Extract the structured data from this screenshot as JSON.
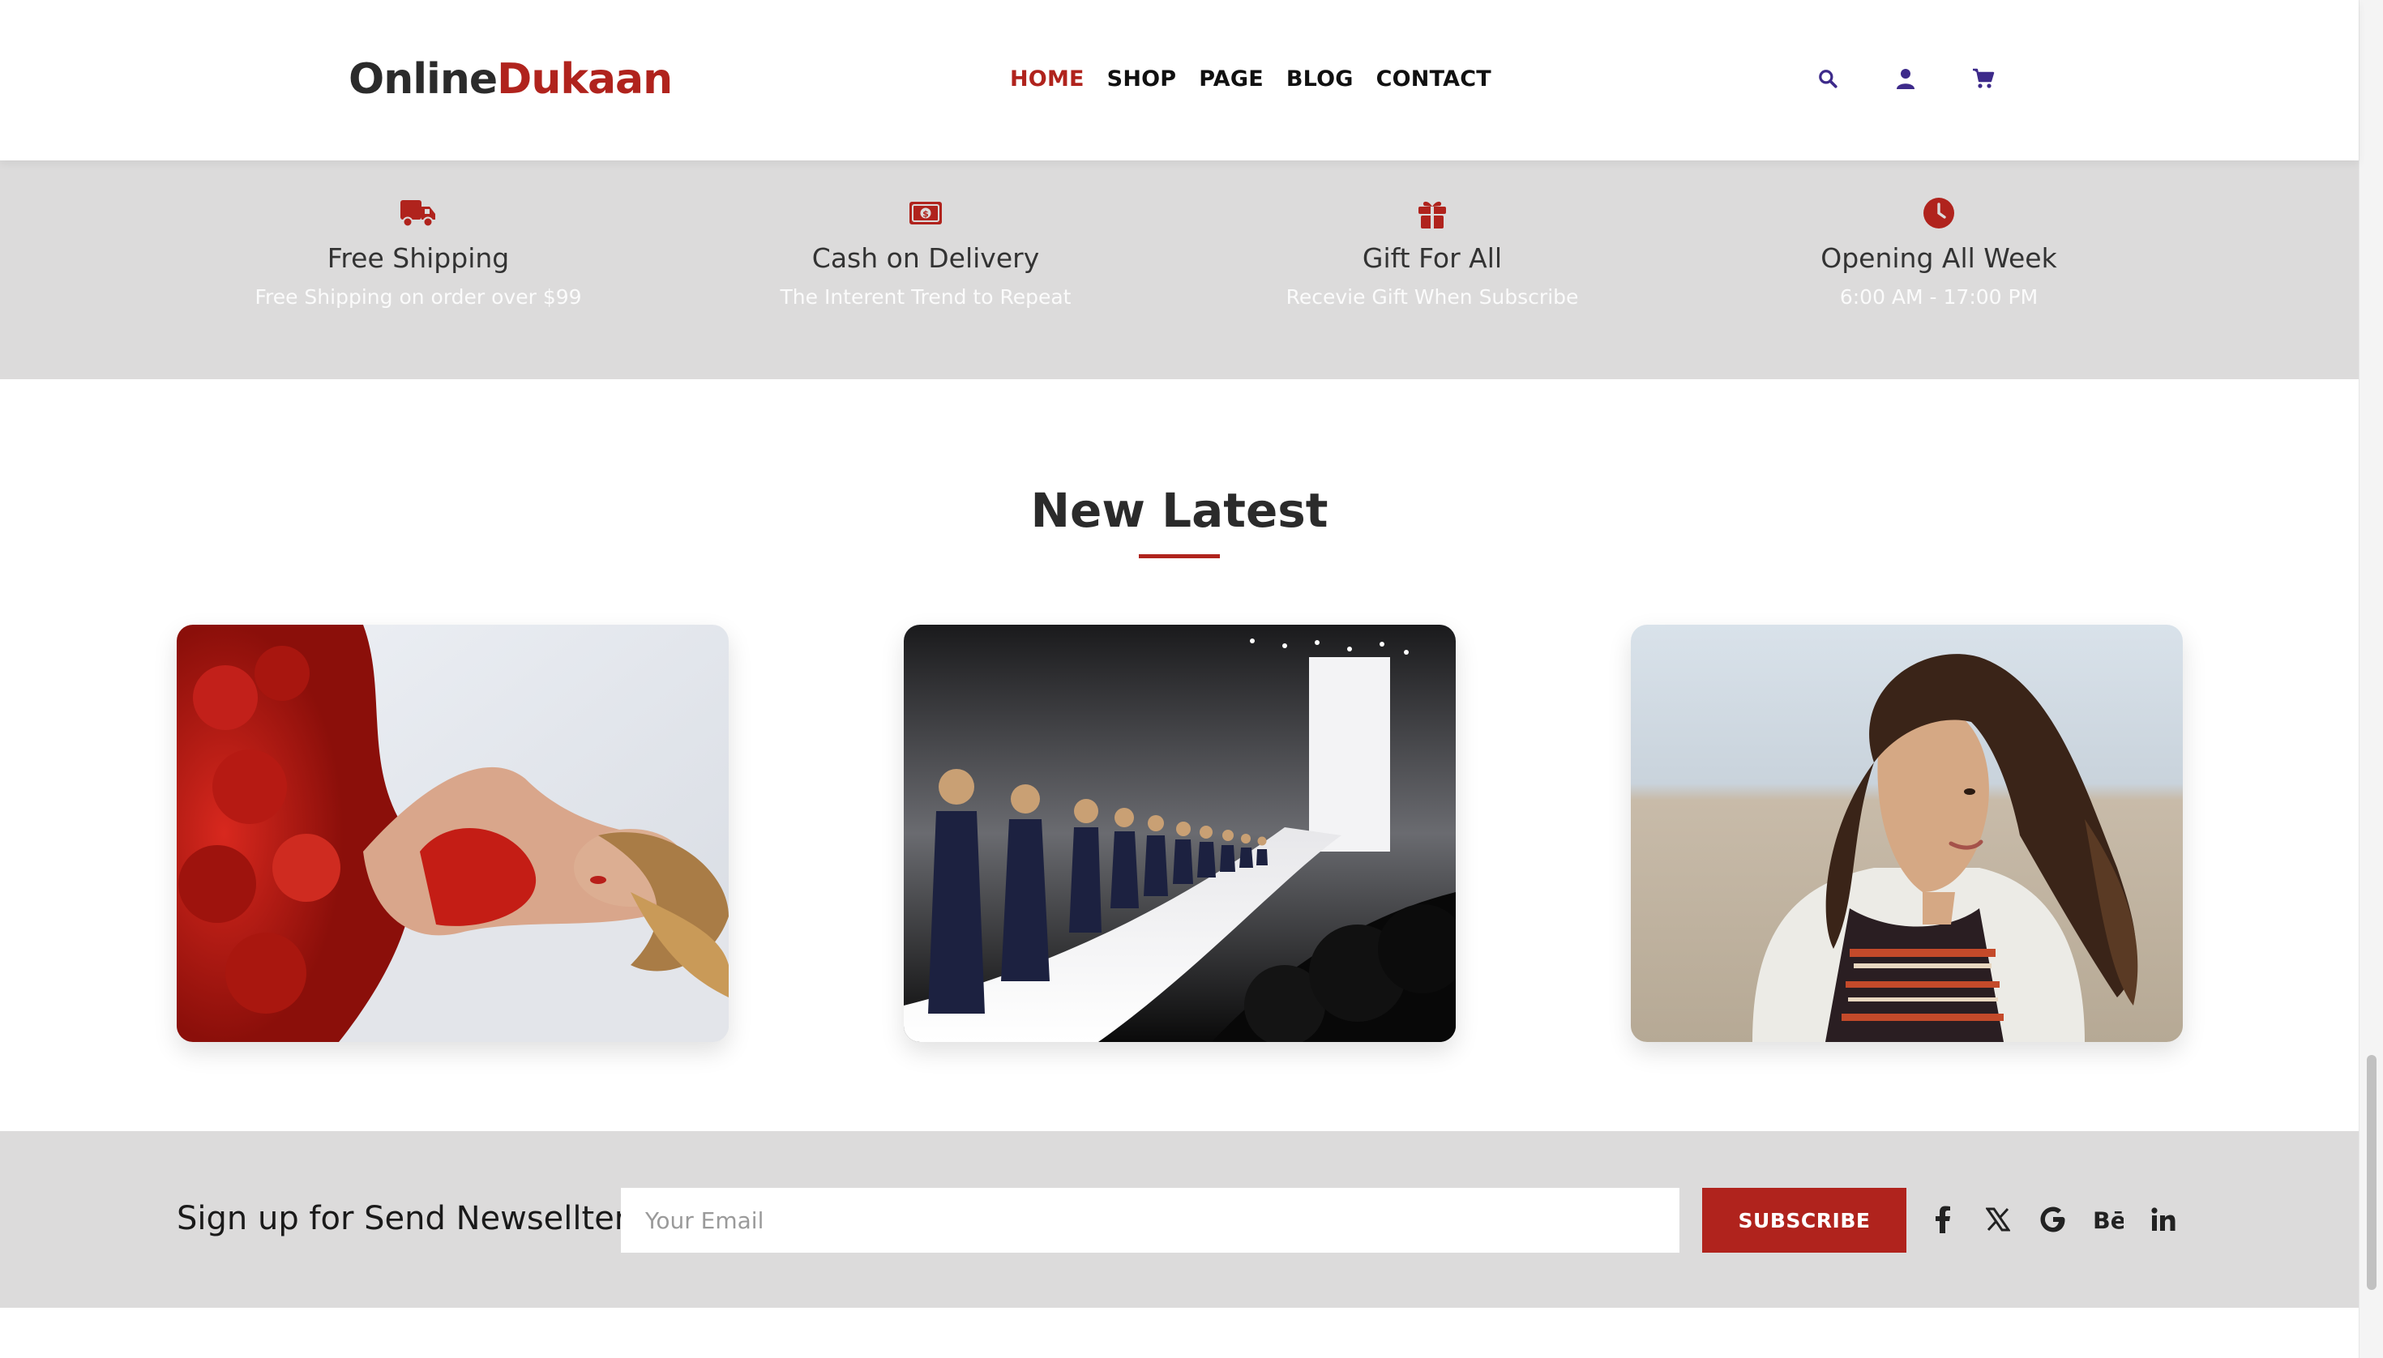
{
  "header": {
    "logo_part1": "Online",
    "logo_part2": "Dukaan",
    "nav": [
      "HOME",
      "SHOP",
      "PAGE",
      "BLOG",
      "CONTACT"
    ],
    "active_nav": "HOME",
    "icons": [
      "search-icon",
      "user-icon",
      "cart-icon"
    ]
  },
  "features": [
    {
      "icon": "truck-icon",
      "title": "Free Shipping",
      "subtitle": "Free Shipping on order over $99"
    },
    {
      "icon": "cash-icon",
      "title": "Cash on Delivery",
      "subtitle": "The Interent Trend to Repeat"
    },
    {
      "icon": "gift-icon",
      "title": "Gift For All",
      "subtitle": "Recevie Gift When Subscribe"
    },
    {
      "icon": "clock-icon",
      "title": "Opening All Week",
      "subtitle": "6:00 AM - 17:00 PM"
    }
  ],
  "section": {
    "title": "New Latest"
  },
  "newsletter": {
    "label": "Sign up for Send Newsellter",
    "placeholder": "Your Email",
    "button": "SUBSCRIBE",
    "social": [
      "facebook-icon",
      "x-icon",
      "google-icon",
      "behance-icon",
      "linkedin-icon"
    ]
  },
  "colors": {
    "accent": "#b0231d",
    "band": "#dcdbdb",
    "icon_purple": "#3d2a8a"
  }
}
